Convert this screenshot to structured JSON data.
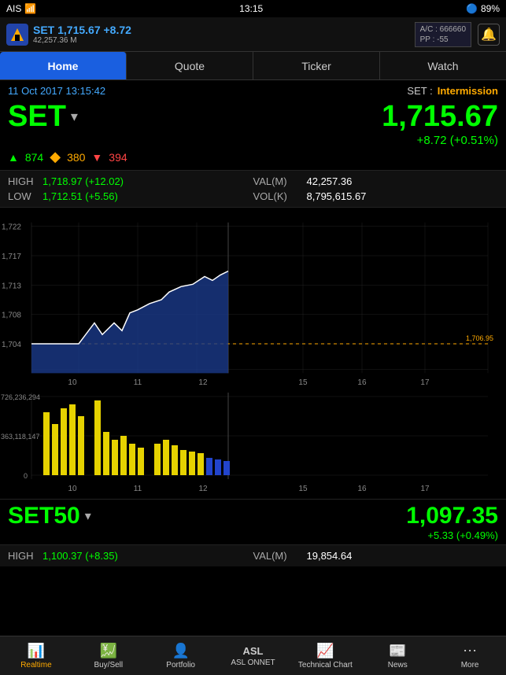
{
  "statusBar": {
    "carrier": "AIS",
    "time": "13:15",
    "battery": "89%",
    "wifi": true,
    "bluetooth": true
  },
  "header": {
    "logoText": "🏠",
    "indexName": "SET 1,715.67 +8.72",
    "indexVolume": "42,257.36 M",
    "accountVC": "A/C : 666660",
    "accountPP": "PP : -55",
    "bellIcon": "🔔"
  },
  "navTabs": [
    {
      "label": "Home",
      "active": true
    },
    {
      "label": "Quote",
      "active": false
    },
    {
      "label": "Ticker",
      "active": false
    },
    {
      "label": "Watch",
      "active": false
    }
  ],
  "dateTime": "11 Oct 2017 13:15:42",
  "marketLabel": "SET :",
  "marketStatus": "Intermission",
  "setIndex": {
    "name": "SET",
    "price": "1,715.67",
    "change": "+8.72 (+0.51%)",
    "advance": "874",
    "unchanged": "380",
    "decline": "394"
  },
  "setHL": {
    "high": "1,718.97 (+12.02)",
    "low": "1,712.51 (+5.56)",
    "valM": "42,257.36",
    "volK": "8,795,615.67"
  },
  "priceChart": {
    "yLabels": [
      "1,722",
      "1,717",
      "1,713",
      "1,708",
      "1,704"
    ],
    "xLabels": [
      "10",
      "11",
      "12",
      "",
      "15",
      "16",
      "17"
    ],
    "refLine": "1,706.95"
  },
  "volChart": {
    "yLabels": [
      "726,236,294",
      "363,118,147",
      "0"
    ],
    "xLabels": [
      "10",
      "11",
      "12",
      "",
      "15",
      "16",
      "17"
    ]
  },
  "set50": {
    "name": "SET50",
    "price": "1,097.35",
    "change": "+5.33 (+0.49%)",
    "high": "1,100.37 (+8.35)",
    "low": "",
    "valM": "19,854.64",
    "volK": ""
  },
  "bottomBar": {
    "tabs": [
      {
        "icon": "📊",
        "label": "Realtime",
        "active": true
      },
      {
        "icon": "💹",
        "label": "Buy/Sell",
        "active": false
      },
      {
        "icon": "👤",
        "label": "Portfolio",
        "active": false
      },
      {
        "icon": "📈",
        "label": "ASL ONNET",
        "active": false
      },
      {
        "icon": "📉",
        "label": "Technical Chart",
        "active": false
      },
      {
        "icon": "📰",
        "label": "News",
        "active": false
      },
      {
        "icon": "⋯",
        "label": "More",
        "active": false
      }
    ]
  }
}
